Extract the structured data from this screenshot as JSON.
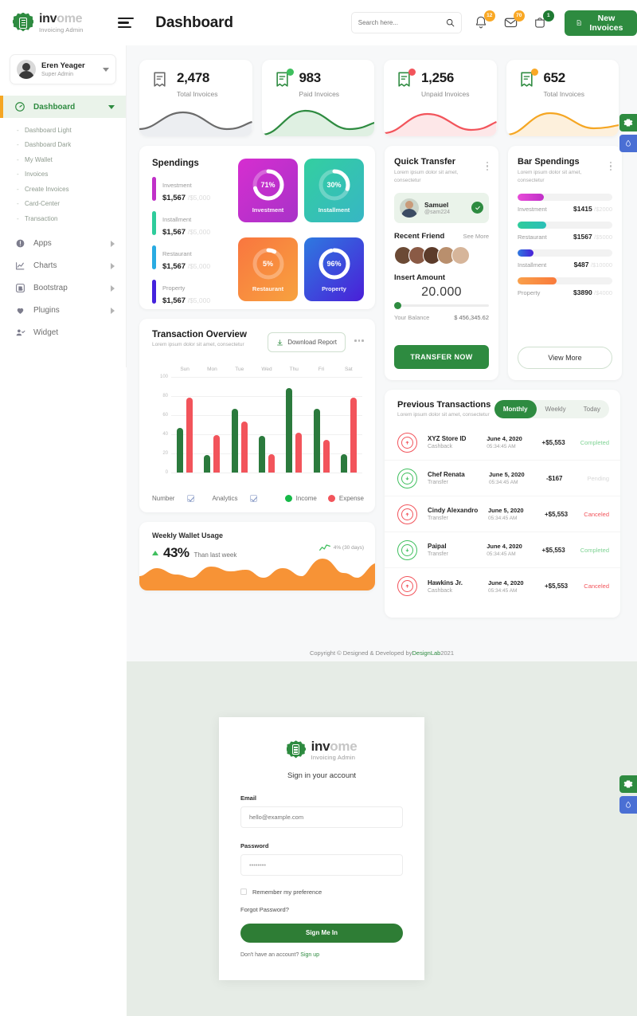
{
  "brand": {
    "name_bold": "inv",
    "name_dim": "ome",
    "tagline": "Invoicing Admin"
  },
  "header": {
    "page_title": "Dashboard",
    "search_placeholder": "Search here...",
    "badges": {
      "bell": "12",
      "mail": "70",
      "cart": "1"
    },
    "new_invoices_label": "New Invoices"
  },
  "sidebar": {
    "profile": {
      "name": "Eren Yeager",
      "role": "Super Admin"
    },
    "active": {
      "label": "Dashboard"
    },
    "sub_items": [
      {
        "label": "Dashboard Light"
      },
      {
        "label": "Dashboard Dark"
      },
      {
        "label": "My Wallet"
      },
      {
        "label": "Invoices"
      },
      {
        "label": "Create Invoices"
      },
      {
        "label": "Card-Center"
      },
      {
        "label": "Transaction"
      }
    ],
    "items": [
      {
        "label": "Apps"
      },
      {
        "label": "Charts"
      },
      {
        "label": "Bootstrap"
      },
      {
        "label": "Plugins"
      },
      {
        "label": "Widget"
      }
    ]
  },
  "stats": [
    {
      "value": "2,478",
      "label": "Total Invoices",
      "color": "#6b6b6b",
      "dot": ""
    },
    {
      "value": "983",
      "label": "Paid Invoices",
      "color": "#2e8b40",
      "dot": "#3fbf5e"
    },
    {
      "value": "1,256",
      "label": "Unpaid Invoices",
      "color": "#e8394a",
      "dot": "#f2545b"
    },
    {
      "value": "652",
      "label": "Total Invoices",
      "color": "#f5a623",
      "dot": "#f9a825"
    }
  ],
  "spendings": {
    "title": "Spendings",
    "items": [
      {
        "name": "Investment",
        "amount": "$1,567",
        "of": "/$5,000",
        "color": "#c030c8",
        "pct": "71%"
      },
      {
        "name": "Installment",
        "amount": "$1,567",
        "of": "/$5,000",
        "color": "#2ecc9b",
        "pct": "30%"
      },
      {
        "name": "Restaurant",
        "amount": "$1,567",
        "of": "/$5,000",
        "color": "#29abe2",
        "pct": "5%"
      },
      {
        "name": "Property",
        "amount": "$1,567",
        "of": "/$5,000",
        "color": "#4422dd",
        "pct": "96%"
      }
    ],
    "donuts": [
      {
        "label": "Investment",
        "pct": "71%",
        "value": 71,
        "g1": "#d62ed0",
        "g2": "#a832c8"
      },
      {
        "label": "Installment",
        "pct": "30%",
        "value": 30,
        "g1": "#2ecc9b",
        "g2": "#3bb9c8"
      },
      {
        "label": "Restaurant",
        "pct": "5%",
        "value": 5,
        "g1": "#f9704b",
        "g2": "#f5a council"
      },
      {
        "label": "Property",
        "pct": "96%",
        "value": 96,
        "g1": "#2e7ae0",
        "g2": "#4a1fd8"
      }
    ]
  },
  "quick_transfer": {
    "title": "Quick Transfer",
    "subtitle": "Lorem ipsum dolor sit amet, consectetur",
    "person": {
      "name": "Samuel",
      "handle": "@sam224"
    },
    "recent_friend_label": "Recent Friend",
    "see_more_label": "See More",
    "insert_amount_label": "Insert Amount",
    "amount": "20.000",
    "balance_label": "Your Balance",
    "balance_value": "$ 456,345.62",
    "button_label": "TRANSFER NOW"
  },
  "bar_spendings": {
    "title": "Bar Spendings",
    "subtitle": "Lorem ipsum dolor sit amet, consectetur",
    "items": [
      {
        "name": "Investment",
        "value": "$1415",
        "of": "/$2000",
        "pct": 18,
        "c1": "#e84bd8",
        "c2": "#c030c8"
      },
      {
        "name": "Restaurant",
        "value": "$1567",
        "of": "/$5000",
        "pct": 27,
        "c1": "#2ecc9b",
        "c2": "#2bbfb8"
      },
      {
        "name": "Installment",
        "value": "$487",
        "of": "/$10000",
        "pct": 14,
        "c1": "#2e7ae0",
        "c2": "#4a1fd8"
      },
      {
        "name": "Property",
        "value": "$3890",
        "of": "/$4000",
        "pct": 38,
        "c1": "#f9a04b",
        "c2": "#f97a3b"
      }
    ],
    "button_label": "View More"
  },
  "transaction_overview": {
    "title": "Transaction Overview",
    "subtitle": "Lorem ipsum dolor sit amet, consectetur",
    "download_label": "Download Report",
    "legend": {
      "number_label": "Number",
      "analytics_label": "Analytics",
      "income_label": "Income",
      "expense_label": "Expense"
    }
  },
  "chart_data": {
    "type": "bar",
    "title": "Transaction Overview",
    "categories": [
      "Sun",
      "Mon",
      "Tue",
      "Wed",
      "Thu",
      "Fri",
      "Sat"
    ],
    "series": [
      {
        "name": "Income",
        "color": "#2b7a3d",
        "values": [
          47,
          18,
          67,
          38,
          88,
          67,
          19
        ]
      },
      {
        "name": "Expense",
        "color": "#f2545b",
        "values": [
          78,
          39,
          53,
          19,
          42,
          34,
          78
        ]
      }
    ],
    "ylim": [
      0,
      100
    ],
    "yticks": [
      "100",
      "80",
      "60",
      "40",
      "20",
      "0"
    ],
    "xlabel": "",
    "ylabel": "",
    "grid": true,
    "legend_position": "bottom-right"
  },
  "weekly_wallet": {
    "title": "Weekly Wallet Usage",
    "percent": "43%",
    "compare": "Than last week",
    "trend": "4% (30 days)"
  },
  "previous_transactions": {
    "title": "Previous Transactions",
    "subtitle": "Lorem ipsum dolor sit amet, consectetur",
    "tabs": [
      {
        "label": "Monthly",
        "active": true
      },
      {
        "label": "Weekly",
        "active": false
      },
      {
        "label": "Today",
        "active": false
      }
    ],
    "rows": [
      {
        "name": "XYZ Store ID",
        "type": "Cashback",
        "date": "June 4, 2020",
        "time": "05:34:45 AM",
        "amount": "+$5,553",
        "status": "Completed",
        "status_class": "completed",
        "dir": "out"
      },
      {
        "name": "Chef Renata",
        "type": "Transfer",
        "date": "June 5, 2020",
        "time": "05:34:45 AM",
        "amount": "-$167",
        "status": "Pending",
        "status_class": "pending",
        "dir": "in"
      },
      {
        "name": "Cindy Alexandro",
        "type": "Transfer",
        "date": "June 5, 2020",
        "time": "05:34:45 AM",
        "amount": "+$5,553",
        "status": "Canceled",
        "status_class": "canceled",
        "dir": "out"
      },
      {
        "name": "Paipal",
        "type": "Transfer",
        "date": "June 4, 2020",
        "time": "05:34:45 AM",
        "amount": "+$5,553",
        "status": "Completed",
        "status_class": "completed",
        "dir": "in"
      },
      {
        "name": "Hawkins Jr.",
        "type": "Cashback",
        "date": "June 4, 2020",
        "time": "05:34:45 AM",
        "amount": "+$5,553",
        "status": "Canceled",
        "status_class": "canceled",
        "dir": "out"
      }
    ]
  },
  "footer": {
    "text_before": "Copyright © Designed & Developed by ",
    "link": "DesignLab",
    "text_after": " 2021"
  },
  "login": {
    "heading": "Sign in your account",
    "email_label": "Email",
    "email_placeholder": "hello@example.com",
    "password_label": "Password",
    "password_value": "••••••••",
    "remember_label": "Remember my preference",
    "forgot_label": "Forgot Password?",
    "submit_label": "Sign Me In",
    "footer_text": "Don't have an account? ",
    "signup_label": "Sign up"
  },
  "colors": {
    "brand_green": "#2e8b40",
    "accent_orange": "#f5a623",
    "danger": "#f2545b",
    "success": "#3fbf5e"
  }
}
